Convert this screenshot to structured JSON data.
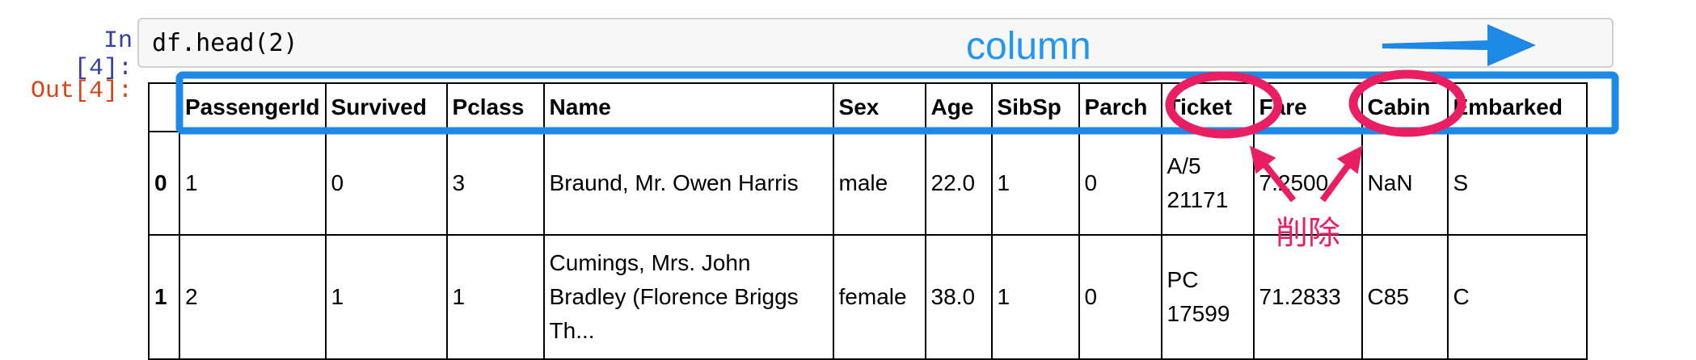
{
  "input": {
    "prompt": "In [4]:",
    "code": "df.head(2)"
  },
  "output": {
    "prompt": "Out[4]:",
    "columns": [
      "PassengerId",
      "Survived",
      "Pclass",
      "Name",
      "Sex",
      "Age",
      "SibSp",
      "Parch",
      "Ticket",
      "Fare",
      "Cabin",
      "Embarked"
    ],
    "rows": [
      {
        "index": "0",
        "cells": [
          "1",
          "0",
          "3",
          "Braund, Mr. Owen Harris",
          "male",
          "22.0",
          "1",
          "0",
          "A/5 21171",
          "7.2500",
          "NaN",
          "S"
        ]
      },
      {
        "index": "1",
        "cells": [
          "2",
          "1",
          "1",
          "Cumings, Mrs. John Bradley (Florence Briggs Th...",
          "female",
          "38.0",
          "1",
          "0",
          "PC 17599",
          "71.2833",
          "C85",
          "C"
        ]
      }
    ]
  },
  "annotations": {
    "column_label": "column",
    "delete_label": "削除",
    "highlight_color": "#1e88e5",
    "circle_color": "#e91e63"
  }
}
